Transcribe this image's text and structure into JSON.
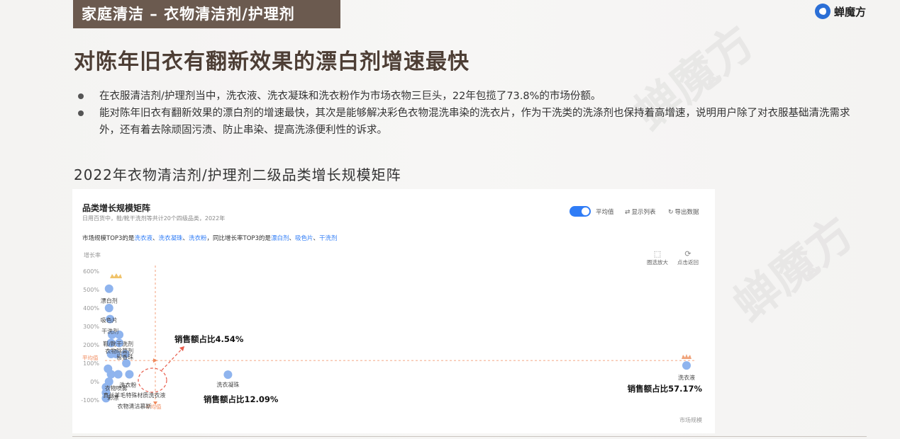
{
  "header": {
    "tag": "家庭清洁 – 衣物清洁剂/护理剂",
    "brand": "蝉魔方"
  },
  "headline": "对陈年旧衣有翻新效果的漂白剂增速最快",
  "bullets": [
    "在衣服清洁剂/护理剂当中，洗衣液、洗衣凝珠和洗衣粉作为市场衣物三巨头，22年包揽了73.8%的市场份额。",
    "能对陈年旧衣有翻新效果的漂白剂的增速最快，其次是能够解决彩色衣物混洗串染的洗衣片，作为干洗类的洗涤剂也保持着高增速，说明用户除了对衣服基础清洗需求外，还有着去除顽固污渍、防止串染、提高洗涤便利性的诉求。"
  ],
  "section_title": "2022年衣物清洁剂/护理剂二级品类增长规模矩阵",
  "panel": {
    "title": "品类增长规模矩阵",
    "subtitle": "日用百货中，鞋/靴干洗剂等共计20个四级品类，2022年",
    "note_prefix": "市场规模TOP3的是",
    "note_top_size": [
      "洗衣液",
      "洗衣凝珠",
      "洗衣粉"
    ],
    "note_mid": "同比增长率TOP3的是",
    "note_top_growth": [
      "漂白剂",
      "吸色片",
      "干洗剂"
    ],
    "toggle_label": "平均值",
    "show_list": "显示列表",
    "export": "导出数据",
    "zoom": "圈选放大",
    "reset": "点击返回",
    "sep1": "、",
    "sep2": "，"
  },
  "chart_data": {
    "type": "scatter",
    "ylabel": "增长率",
    "xlabel": "市场规模",
    "y_ticks": [
      "600%",
      "500%",
      "400%",
      "300%",
      "200%",
      "100%",
      "0%",
      "-100%"
    ],
    "ylim": [
      -100,
      600
    ],
    "avg_y_label": "平均值",
    "avg_x_label": "平均值",
    "avg_growth": 115,
    "point_color": "#8fb4ee",
    "avg_color": "#f08a5d",
    "points": [
      {
        "label": "漂白剂",
        "x": 0.4,
        "y": 505
      },
      {
        "label": "吸色片",
        "x": 0.4,
        "y": 400
      },
      {
        "label": "干洗剂",
        "x": 0.5,
        "y": 340
      },
      {
        "label": "",
        "x": 0.7,
        "y": 255
      },
      {
        "label": "",
        "x": 1.4,
        "y": 255
      },
      {
        "label": "鞋/靴干洗剂",
        "x": 0.6,
        "y": 210
      },
      {
        "label": "衣物除菌剂",
        "x": 1.4,
        "y": 210
      },
      {
        "label": "",
        "x": 0.6,
        "y": 150
      },
      {
        "label": "",
        "x": 1.1,
        "y": 150
      },
      {
        "label": "",
        "x": 2.0,
        "y": 150
      },
      {
        "label": "留香珠",
        "x": 2.1,
        "y": 100
      },
      {
        "label": "",
        "x": 0.3,
        "y": 70
      },
      {
        "label": "",
        "x": 0.6,
        "y": 40
      },
      {
        "label": "",
        "x": 1.3,
        "y": 40
      },
      {
        "label": "洗衣粉",
        "x": 2.4,
        "y": 40
      },
      {
        "label": "衣物喷雾",
        "x": 0.4,
        "y": 0
      },
      {
        "label": "真丝羊毛特殊材质洗衣液",
        "x": 0.1,
        "y": -30
      },
      {
        "label": "彩漂",
        "x": 0.1,
        "y": -60
      },
      {
        "label": "衣物清洁慕斯",
        "x": 0.1,
        "y": -90
      },
      {
        "label": "洗衣凝珠",
        "x": 12.09,
        "y": 38
      },
      {
        "label": "洗衣液",
        "x": 57.17,
        "y": 88
      }
    ],
    "annotations": [
      {
        "text": "销售额占比4.54%"
      },
      {
        "text": "销售额占比12.09%"
      },
      {
        "text": "销售额占比57.17%"
      }
    ]
  }
}
